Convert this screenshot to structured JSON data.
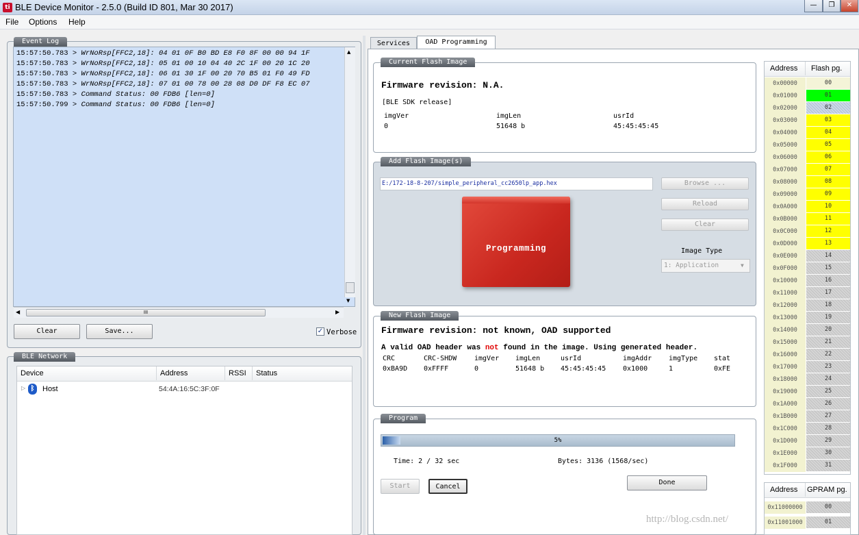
{
  "window": {
    "title": "BLE Device Monitor - 2.5.0 (Build ID 801, Mar 30 2017)",
    "minimize": "—",
    "restore": "❐",
    "close": "✕"
  },
  "menu": [
    "File",
    "Options",
    "Help"
  ],
  "event_log": {
    "legend": "Event Log",
    "lines": [
      {
        "time": "15:57:50.783",
        "cmd": "WrNoRsp[FFC2,18]",
        "data": ": 04 01 0F B0 BD E8 F0 8F 00 00 94 1F"
      },
      {
        "time": "15:57:50.783",
        "cmd": "WrNoRsp[FFC2,18]",
        "data": ": 05 01 00 10 04 40 2C 1F 00 20 1C 20"
      },
      {
        "time": "15:57:50.783",
        "cmd": "WrNoRsp[FFC2,18]",
        "data": ": 06 01 30 1F 00 20 70 B5 01 F0 49 FD"
      },
      {
        "time": "15:57:50.783",
        "cmd": "WrNoRsp[FFC2,18]",
        "data": ": 07 01 00 78 00 28 08 D0 DF F8 EC 07"
      },
      {
        "time": "15:57:50.783",
        "cmd": "Command Status",
        "data": ": 00 FDB6 [len=0]"
      },
      {
        "time": "15:57:50.799",
        "cmd": "Command Status",
        "data": ": 00 FDB6 [len=0]"
      }
    ],
    "prefix": " > ",
    "scroll_thumb": "III",
    "clear_label": "Clear",
    "save_label": "Save...",
    "verbose_label": "Verbose",
    "verbose_checked": true
  },
  "ble_network": {
    "legend": "BLE Network",
    "columns": [
      "Device",
      "Address",
      "RSSI",
      "Status"
    ],
    "rows": [
      {
        "device": "Host",
        "address": "54:4A:16:5C:3F:0F",
        "rssi": "",
        "status": ""
      }
    ]
  },
  "tabs": [
    "Services",
    "OAD Programming"
  ],
  "active_tab": "OAD Programming",
  "current_image": {
    "legend": "Current Flash Image",
    "firmware": "Firmware revision: N.A.",
    "sdk": "[BLE SDK release]",
    "headers": [
      "imgVer",
      "imgLen",
      "usrId"
    ],
    "values": [
      "0",
      "51648 b",
      "45:45:45:45"
    ]
  },
  "add_image": {
    "legend": "Add Flash Image(s)",
    "path": "E:/172-18-8-207/simple_peripheral_cc2650lp_app.hex",
    "browse": "Browse ...",
    "reload": "Reload",
    "clear": "Clear",
    "overlay": "Programming",
    "image_type_label": "Image Type",
    "image_type_value": "1: Application"
  },
  "new_image": {
    "legend": "New Flash Image",
    "firmware": "Firmware revision: not known, OAD supported",
    "warn_pre": "A valid OAD header was ",
    "warn_not": "not",
    "warn_post": " found in the image. Using generated header.",
    "headers": [
      "CRC",
      "CRC-SHDW",
      "imgVer",
      "imgLen",
      "usrId",
      "imgAddr",
      "imgType",
      "stat"
    ],
    "values": [
      "0xBA9D",
      "0xFFFF",
      "0",
      "51648 b",
      "45:45:45:45",
      "0x1000",
      "1",
      "0xFE"
    ]
  },
  "program": {
    "legend": "Program",
    "progress": 0.05,
    "progress_label": "5%",
    "time": "Time: 2 / 32 sec",
    "bytes": "Bytes: 3136 (1568/sec)",
    "start": "Start",
    "cancel": "Cancel",
    "done": "Done"
  },
  "flash_table": {
    "headers": [
      "Address",
      "Flash pg."
    ],
    "rows": [
      {
        "addr": "0x00000",
        "pg": "00",
        "state": "empty"
      },
      {
        "addr": "0x01000",
        "pg": "01",
        "state": "active"
      },
      {
        "addr": "0x02000",
        "pg": "02",
        "state": "blue"
      },
      {
        "addr": "0x03000",
        "pg": "03",
        "state": "used"
      },
      {
        "addr": "0x04000",
        "pg": "04",
        "state": "used"
      },
      {
        "addr": "0x05000",
        "pg": "05",
        "state": "used"
      },
      {
        "addr": "0x06000",
        "pg": "06",
        "state": "used"
      },
      {
        "addr": "0x07000",
        "pg": "07",
        "state": "used"
      },
      {
        "addr": "0x08000",
        "pg": "08",
        "state": "used"
      },
      {
        "addr": "0x09000",
        "pg": "09",
        "state": "used"
      },
      {
        "addr": "0x0A000",
        "pg": "10",
        "state": "used"
      },
      {
        "addr": "0x0B000",
        "pg": "11",
        "state": "used"
      },
      {
        "addr": "0x0C000",
        "pg": "12",
        "state": "used"
      },
      {
        "addr": "0x0D000",
        "pg": "13",
        "state": "used"
      },
      {
        "addr": "0x0E000",
        "pg": "14",
        "state": "free"
      },
      {
        "addr": "0x0F000",
        "pg": "15",
        "state": "free"
      },
      {
        "addr": "0x10000",
        "pg": "16",
        "state": "free"
      },
      {
        "addr": "0x11000",
        "pg": "17",
        "state": "free"
      },
      {
        "addr": "0x12000",
        "pg": "18",
        "state": "free"
      },
      {
        "addr": "0x13000",
        "pg": "19",
        "state": "free"
      },
      {
        "addr": "0x14000",
        "pg": "20",
        "state": "free"
      },
      {
        "addr": "0x15000",
        "pg": "21",
        "state": "free"
      },
      {
        "addr": "0x16000",
        "pg": "22",
        "state": "free"
      },
      {
        "addr": "0x17000",
        "pg": "23",
        "state": "free"
      },
      {
        "addr": "0x18000",
        "pg": "24",
        "state": "free"
      },
      {
        "addr": "0x19000",
        "pg": "25",
        "state": "free"
      },
      {
        "addr": "0x1A000",
        "pg": "26",
        "state": "free"
      },
      {
        "addr": "0x1B000",
        "pg": "27",
        "state": "free"
      },
      {
        "addr": "0x1C000",
        "pg": "28",
        "state": "free"
      },
      {
        "addr": "0x1D000",
        "pg": "29",
        "state": "free"
      },
      {
        "addr": "0x1E000",
        "pg": "30",
        "state": "free"
      },
      {
        "addr": "0x1F000",
        "pg": "31",
        "state": "free"
      }
    ]
  },
  "gpram_table": {
    "headers": [
      "Address",
      "GPRAM pg."
    ],
    "rows": [
      {
        "addr": "0x11000000",
        "pg": "00"
      },
      {
        "addr": "0x11001000",
        "pg": "01"
      }
    ]
  },
  "colors": {
    "active": "#00ff00",
    "used": "#ffff00",
    "free": "#c8c8c8",
    "empty": "#f4f4d8",
    "blue": "#b8c8dc",
    "overlay_red": "#d9302c",
    "warn_red": "#e00000"
  },
  "watermark": "http://blog.csdn.net/"
}
